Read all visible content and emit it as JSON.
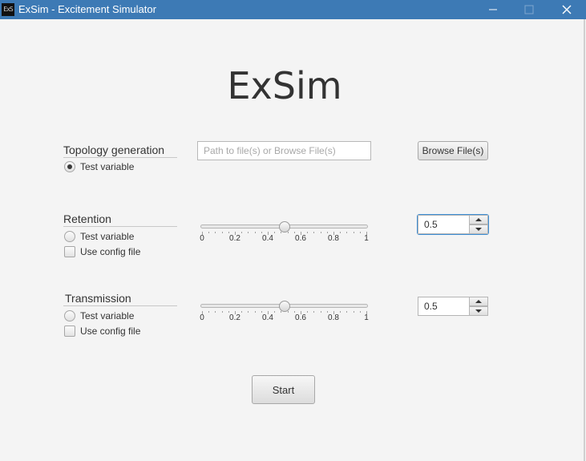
{
  "window": {
    "icon_text": "ExS",
    "title": "ExSim - Excitement Simulator",
    "titlebar_color": "#3d7ab5",
    "controls": [
      "minimize-icon",
      "maximize-icon",
      "close-icon"
    ]
  },
  "heading": "ExSim",
  "topology": {
    "label": "Topology generation",
    "test_variable": {
      "label": "Test variable",
      "checked": true
    },
    "path_field": {
      "value": "",
      "placeholder": "Path to file(s) or Browse File(s)"
    },
    "browse_label": "Browse File(s)"
  },
  "retention": {
    "label": "Retention",
    "test_variable": {
      "label": "Test variable",
      "checked": false
    },
    "use_config": {
      "label": "Use config file",
      "checked": false
    },
    "slider": {
      "min": 0,
      "max": 1,
      "value": 0.5,
      "tick_labels": [
        "0",
        "0.2",
        "0.4",
        "0.6",
        "0.8",
        "1"
      ]
    },
    "spinner_value": "0.5",
    "focused": true
  },
  "transmission": {
    "label": "Transmission",
    "test_variable": {
      "label": "Test variable",
      "checked": false
    },
    "use_config": {
      "label": "Use config file",
      "checked": false
    },
    "slider": {
      "min": 0,
      "max": 1,
      "value": 0.5,
      "tick_labels": [
        "0",
        "0.2",
        "0.4",
        "0.6",
        "0.8",
        "1"
      ]
    },
    "spinner_value": "0.5",
    "focused": false
  },
  "start_label": "Start",
  "colors": {
    "background": "#f4f4f4",
    "focus": "#3d8fd6",
    "text": "#333333"
  }
}
